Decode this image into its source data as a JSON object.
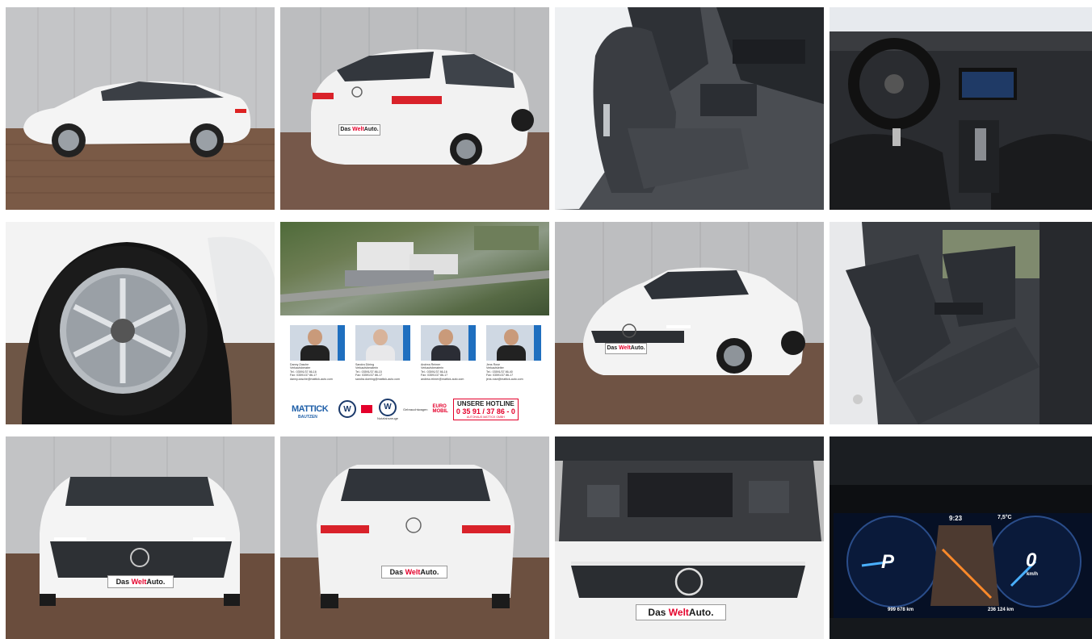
{
  "gallery": {
    "photos": [
      {
        "alt": "Side view of white wagon"
      },
      {
        "alt": "Rear three-quarter view",
        "plate": {
          "pre": "Das ",
          "welt": "Welt",
          "post": "Auto."
        }
      },
      {
        "alt": "Front seats interior"
      },
      {
        "alt": "Dashboard and steering wheel"
      },
      {
        "alt": "Alloy wheel close-up"
      },
      {
        "alt": "Dealership contact card"
      },
      {
        "alt": "Front three-quarter view",
        "plate": {
          "pre": "Das ",
          "welt": "Welt",
          "post": "Auto."
        }
      },
      {
        "alt": "Rear seats interior"
      },
      {
        "alt": "Front view",
        "plate": {
          "pre": "Das ",
          "welt": "Welt",
          "post": "Auto."
        }
      },
      {
        "alt": "Rear view",
        "plate": {
          "pre": "Das ",
          "welt": "Welt",
          "post": "Auto."
        }
      },
      {
        "alt": "Engine bay",
        "plate": {
          "pre": "Das ",
          "welt": "Welt",
          "post": "Auto."
        }
      },
      {
        "alt": "Digital instrument cluster"
      }
    ]
  },
  "dealer_card": {
    "persons": [
      {
        "name": "Danny Zasche",
        "role": "Verkaufsberater",
        "tel": "Tel.: 03591/37 86-16",
        "fax": "Fax: 03591/37 86-17",
        "mail": "danny.zasche@mattick-auto.com"
      },
      {
        "name": "Sandra Döring",
        "role": "Verkaufsberaterin",
        "tel": "Tel.: 03591/37 86-15",
        "fax": "Fax: 03591/37 86-17",
        "mail": "sandra.doering@mattick-auto.com"
      },
      {
        "name": "Andrea Reimer",
        "role": "Verkaufsberaterin",
        "tel": "Tel.: 03591/37 86-16",
        "fax": "Fax: 03591/37 86-17",
        "mail": "andrea.reimer@mattick-auto.com"
      },
      {
        "name": "Jens Rose",
        "role": "Verkaufsleiter",
        "tel": "Tel.: 03591/37 86-40",
        "fax": "Fax: 03591/37 86-17",
        "mail": "jens.rose@mattick-auto.com"
      }
    ],
    "logo_main": "MATTICK",
    "logo_sub": "BAUTZEN",
    "vw_label": "Nutzfahrzeuge",
    "used_cars_label": "Gebrauchtwagen",
    "euro_label_1": "EURO",
    "euro_label_2": "MOBIL",
    "hotline_title": "UNSERE HOTLINE",
    "hotline_number": "0 35 91 / 37 86 - 0",
    "hotline_sub": "AUTOHAUS MATTICK GMBH"
  },
  "cluster": {
    "time": "9:23",
    "temp": "7,5°C",
    "gear": "P",
    "speed": "0",
    "speed_unit": "km/h",
    "range": "999 678 km",
    "trip": "236 124 km"
  }
}
